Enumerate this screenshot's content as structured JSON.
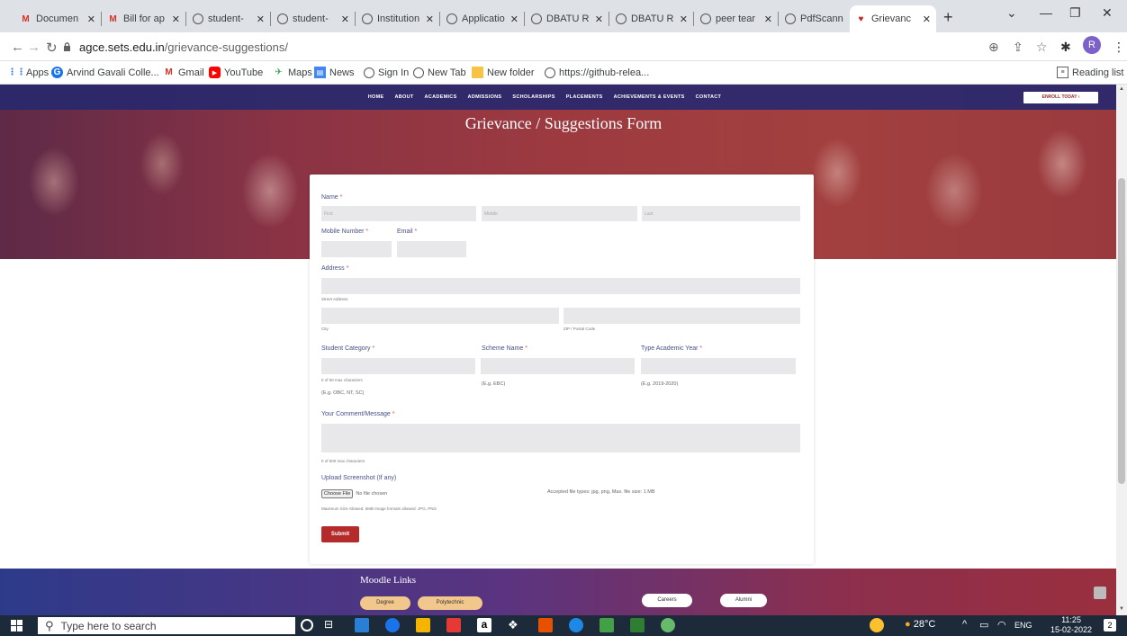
{
  "browser": {
    "tabs": [
      {
        "title": "Documen",
        "icon": "gmail-icon"
      },
      {
        "title": "Bill for ap",
        "icon": "gmail-icon"
      },
      {
        "title": "student-",
        "icon": "globe-icon"
      },
      {
        "title": "student-",
        "icon": "globe-icon"
      },
      {
        "title": "Institution",
        "icon": "globe-icon"
      },
      {
        "title": "Applicatio",
        "icon": "globe-icon"
      },
      {
        "title": "DBATU R",
        "icon": "globe-icon"
      },
      {
        "title": "DBATU R",
        "icon": "globe-icon"
      },
      {
        "title": "peer tear",
        "icon": "globe-icon"
      },
      {
        "title": "PdfScann",
        "icon": "globe-icon"
      },
      {
        "title": "Grievanc",
        "icon": "college-shield-icon",
        "active": true
      }
    ],
    "url_host": "agce.sets.edu.in",
    "url_path": "/grievance-suggestions/",
    "profile_initial": "R",
    "bookmarks": [
      {
        "label": "Apps",
        "icon": "apps-grid-icon"
      },
      {
        "label": "Arvind Gavali Colle...",
        "icon": "college-icon"
      },
      {
        "label": "Gmail",
        "icon": "gmail-icon"
      },
      {
        "label": "YouTube",
        "icon": "youtube-icon"
      },
      {
        "label": "Maps",
        "icon": "maps-icon"
      },
      {
        "label": "News",
        "icon": "news-icon"
      },
      {
        "label": "Sign In",
        "icon": "globe-icon"
      },
      {
        "label": "New Tab",
        "icon": "globe-icon"
      },
      {
        "label": "New folder",
        "icon": "folder-icon"
      },
      {
        "label": "https://github-relea...",
        "icon": "globe-icon"
      }
    ],
    "reading_list": "Reading list"
  },
  "site": {
    "nav": [
      "HOME",
      "ABOUT",
      "ACADEMICS",
      "ADMISSIONS",
      "SCHOLARSHIPS",
      "PLACEMENTS",
      "ACHIEVEMENTS & EVENTS",
      "CONTACT"
    ],
    "enroll": "ENROLL TODAY",
    "page_title": "Grievance / Suggestions Form"
  },
  "form": {
    "name_label": "Name",
    "first_ph": "First",
    "middle_ph": "Middle",
    "last_ph": "Last",
    "mobile_label": "Mobile Number",
    "email_label": "Email",
    "address_label": "Address",
    "street_sub": "Street Address",
    "city_sub": "City",
    "zip_sub": "ZIP / Postal Code",
    "category_label": "Student Category",
    "category_hint": "0 of 50 max characters",
    "category_eg": "(E.g. OBC, NT, SC)",
    "scheme_label": "Scheme Name",
    "scheme_eg": "(E.g. EBC)",
    "year_label": "Type Academic Year",
    "year_eg": "(E.g. 2019-2020)",
    "comment_label": "Your Comment/Message",
    "comment_hint": "0 of 500 max characters",
    "upload_label": "Upload Screenshot (If any)",
    "choose_file": "Choose File",
    "no_file": "No file chosen",
    "accepted": "Accepted file types: jpg, png, Max. file size: 1 MB",
    "max_size": "Maximum Size Allowed: 5MB Image formats allowed: JPG, PNG",
    "submit": "Submit",
    "req": "*"
  },
  "footer": {
    "moodle": "Moodle Links",
    "degree": "Degree",
    "polytechnic": "Polytechnic",
    "careers": "Careers",
    "alumni": "Alumni"
  },
  "taskbar": {
    "search": "Type here to search",
    "weather": "28°C",
    "lang": "ENG",
    "time": "11:25",
    "date": "15-02-2022",
    "notif": "2"
  }
}
